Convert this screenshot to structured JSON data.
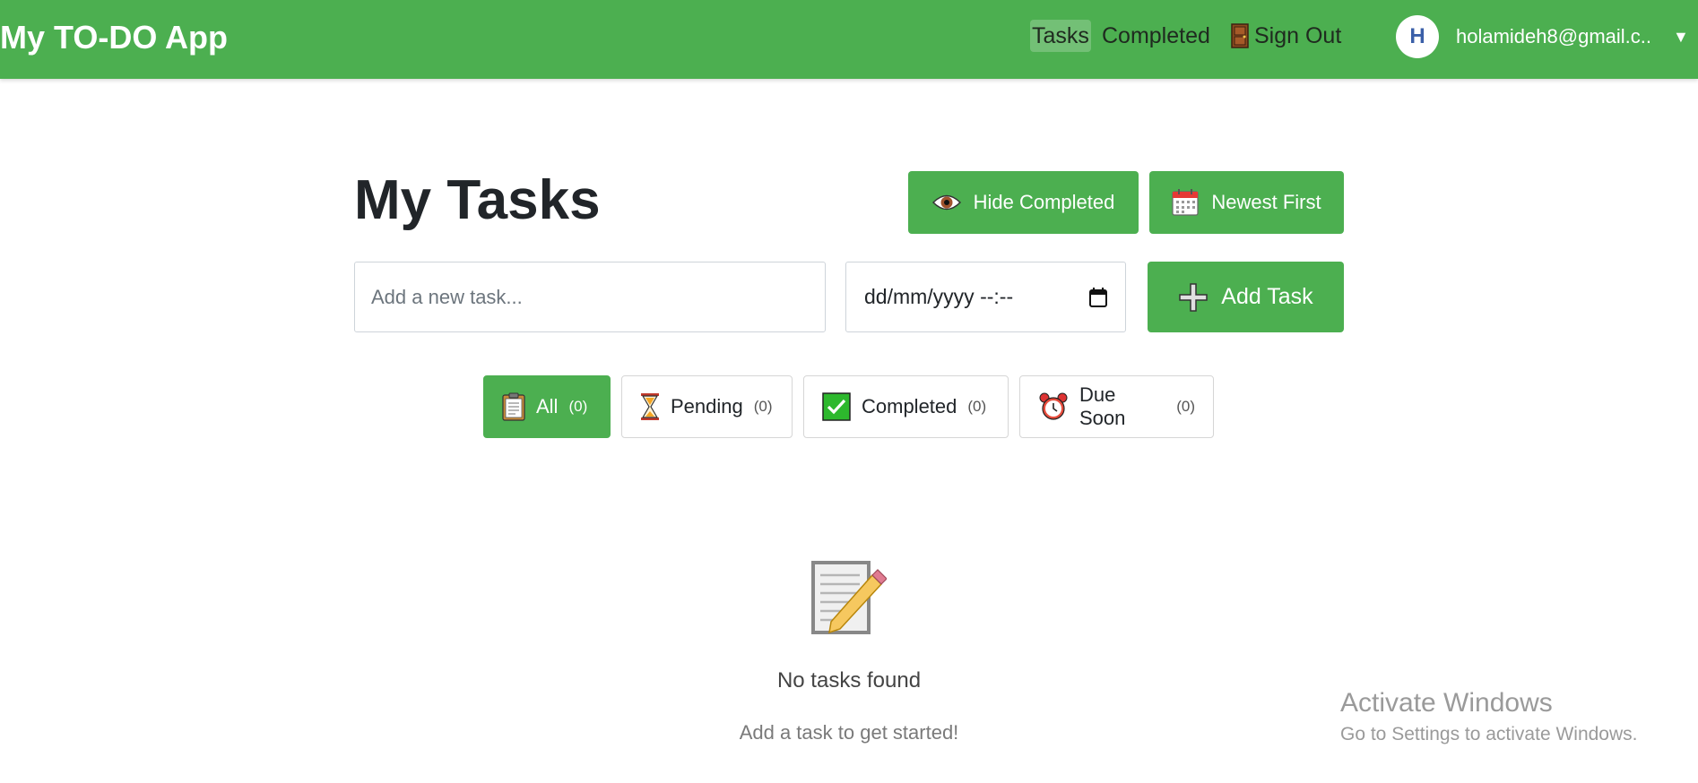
{
  "navbar": {
    "brand": "My TO-DO App",
    "links": [
      "Tasks",
      "Completed",
      "Sign Out"
    ],
    "avatar_initial": "H",
    "user_email": "holamideh8@gmail.c...",
    "accent_color": "#4caf50"
  },
  "header": {
    "title": "My Tasks",
    "hide_completed_label": "Hide Completed",
    "sort_label": "Newest First"
  },
  "new_task": {
    "placeholder": "Add a new task...",
    "date_placeholder": "dd/mm/yyyy --:--",
    "add_label": "Add Task"
  },
  "filters": [
    {
      "label": "All",
      "count": "(0)",
      "icon": "clipboard-icon",
      "active": true
    },
    {
      "label": "Pending",
      "count": "(0)",
      "icon": "hourglass-icon",
      "active": false
    },
    {
      "label": "Completed",
      "count": "(0)",
      "icon": "checkbox-icon",
      "active": false
    },
    {
      "label": "Due Soon",
      "count": "(0)",
      "icon": "alarm-clock-icon",
      "active": false
    }
  ],
  "empty_state": {
    "icon": "memo-icon",
    "title": "No tasks found",
    "subtitle": "Add a task to get started!"
  },
  "watermark": {
    "title": "Activate Windows",
    "subtitle": "Go to Settings to activate Windows."
  }
}
